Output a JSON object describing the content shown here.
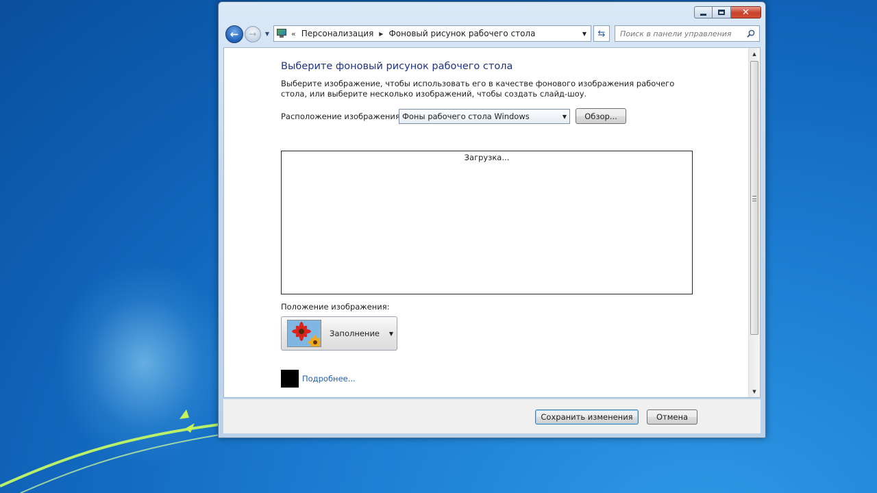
{
  "window": {
    "caption_buttons": {
      "minimize_icon": "minimize-icon",
      "maximize_icon": "maximize-icon",
      "close_label": "✕"
    }
  },
  "navigation": {
    "back_glyph": "←",
    "forward_glyph": "→",
    "history_glyph": "▼",
    "address": {
      "chevrons": "«",
      "breadcrumbs": [
        "Персонализация",
        "Фоновый рисунок рабочего стола"
      ],
      "separator": "▶",
      "dropdown_glyph": "▼"
    },
    "refresh_glyph": "⇆",
    "search": {
      "placeholder": "Поиск в панели управления",
      "value": ""
    }
  },
  "content": {
    "title": "Выберите фоновый рисунок рабочего стола",
    "description": "Выберите изображение, чтобы использовать его в качестве фонового изображения рабочего стола, или выберите несколько изображений, чтобы создать слайд-шоу.",
    "location_label": "Расположение изображения:",
    "location_value": "Фоны рабочего стола Windows",
    "dropdown_glyph": "▼",
    "browse_label": "Обзор...",
    "loading_text": "Загрузка...",
    "position_label": "Положение изображения:",
    "position_value": "Заполнение",
    "swatch_color": "#000000",
    "more_link": "Подробнее..."
  },
  "scrollbar": {
    "up_glyph": "▲",
    "down_glyph": "▼"
  },
  "footer": {
    "save_label": "Сохранить изменения",
    "cancel_label": "Отмена"
  },
  "colors": {
    "title": "#1e3287",
    "link": "#1e5fb0",
    "desktop": "#1b7bd0"
  }
}
